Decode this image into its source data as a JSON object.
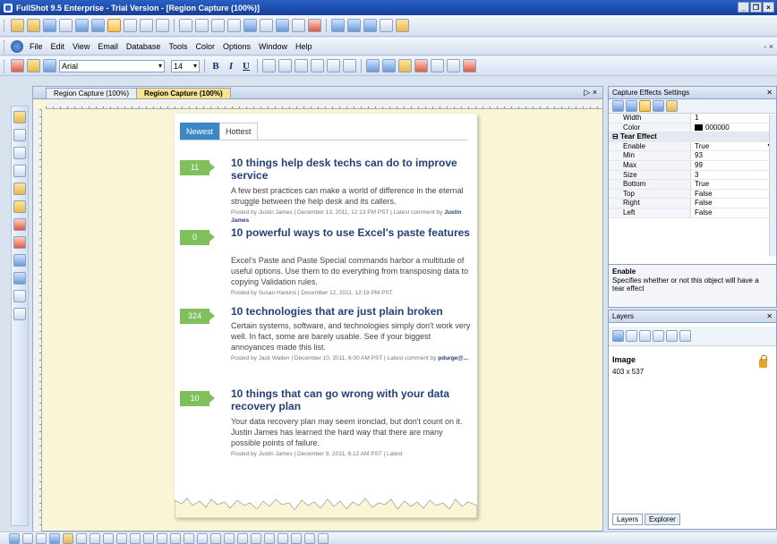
{
  "window": {
    "title": "FullShot 9.5 Enterprise - Trial Version - [Region Capture (100%)]",
    "controls": [
      "_",
      "×"
    ]
  },
  "menu": {
    "items": [
      "File",
      "Edit",
      "View",
      "Email",
      "Database",
      "Tools",
      "Color",
      "Options",
      "Window",
      "Help"
    ],
    "mdi_controls": "- ×"
  },
  "format_bar": {
    "font": "Arial",
    "size": "14",
    "bold": "B",
    "italic": "I",
    "underline": "U"
  },
  "document_tabs": {
    "items": [
      "Region Capture (100%)",
      "Region Capture (100%)"
    ],
    "active_index": 1,
    "controls": "▷ ×"
  },
  "capture": {
    "tabs": [
      "Newest",
      "Hottest"
    ],
    "articles": [
      {
        "count": "11",
        "title": "10 things help desk techs can do to improve service",
        "desc": "A few best practices can make a world of difference in the eternal struggle between the help desk and its callers.",
        "meta": "Posted by Justin James | December 13, 2011, 12:13 PM PST | Latest comment by",
        "meta_author": "Justin James"
      },
      {
        "count": "0",
        "title": "10 powerful ways to use Excel's paste features",
        "desc": "Excel's Paste and Paste Special commands harbor a multitude of useful options. Use them to do everything from transposing data to copying Validation rules.",
        "meta": "Posted by Susan Harkins | December 12, 2011, 12:19 PM PST",
        "meta_author": ""
      },
      {
        "count": "324",
        "title": "10 technologies that are just plain broken",
        "desc": "Certain systems, software, and technologies simply don't work very well. In fact, some are barely usable. See if your biggest annoyances made this list.",
        "meta": "Posted by Jack Wallen | December 10, 2011, 6:00 AM PST | Latest comment by",
        "meta_author": "pdurge@..."
      },
      {
        "count": "10",
        "title": "10 things that can go wrong with your data recovery plan",
        "desc": "Your data recovery plan may seem ironclad, but don't count on it. Justin James has learned the hard way that there are many possible points of failure.",
        "meta": "Posted by Justin James | December 9, 2011, 6:12 AM PST | Latest",
        "meta_author": ""
      }
    ]
  },
  "effects_panel": {
    "title": "Capture Effects Settings",
    "close": "✕",
    "rows": [
      {
        "key": "Width",
        "value": "1"
      },
      {
        "key": "Color",
        "value": "000000"
      }
    ],
    "category": "Tear Effect",
    "tear_rows": [
      {
        "key": "Enable",
        "value": "True"
      },
      {
        "key": "Min",
        "value": "93"
      },
      {
        "key": "Max",
        "value": "99"
      },
      {
        "key": "Size",
        "value": "3"
      },
      {
        "key": "Bottom",
        "value": "True"
      },
      {
        "key": "Top",
        "value": "False"
      },
      {
        "key": "Right",
        "value": "False"
      },
      {
        "key": "Left",
        "value": "False"
      }
    ],
    "desc_title": "Enable",
    "desc_text": "Specifies whether or not this object will have a tear effect"
  },
  "layers_panel": {
    "title": "Layers",
    "close": "✕",
    "item_title": "Image",
    "item_size": "403 x 537",
    "tabs": [
      "Layers",
      "Explorer"
    ]
  },
  "colors": {
    "accent": "#3b88c9",
    "count_badge": "#7fc05d",
    "title_blue": "#25407a",
    "active_tab": "#fbe38c",
    "doc_bg": "#f9f6d6"
  }
}
